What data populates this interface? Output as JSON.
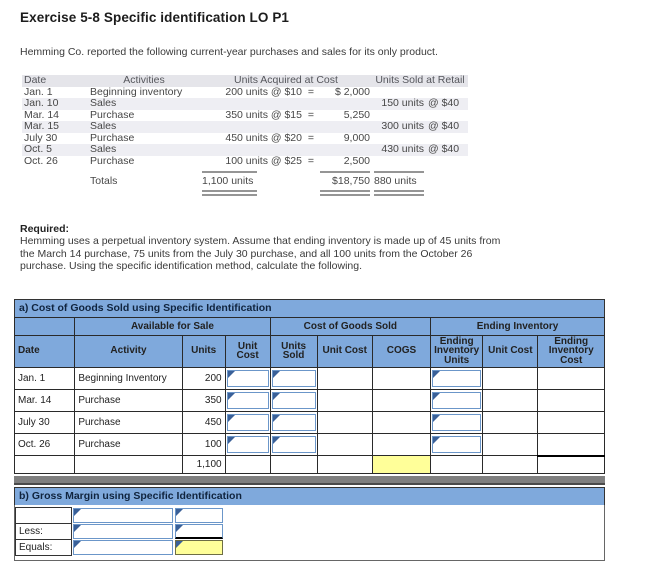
{
  "page": {
    "title": "Exercise 5-8 Specific identification LO P1",
    "intro": "Hemming Co. reported the following current-year purchases and sales for its only product.",
    "required_label": "Required:",
    "required_text": "Hemming uses a perpetual inventory system. Assume that ending inventory is made up of 45 units from the March 14 purchase, 75 units from the July 30 purchase, and all 100 units from the October 26 purchase. Using the specific identification method, calculate the following."
  },
  "purchases_table": {
    "headers": {
      "date": "Date",
      "activities": "Activities",
      "acquired": "Units Acquired at Cost",
      "sold": "Units Sold at Retail"
    },
    "rows": [
      {
        "date": "Jan. 1",
        "activity": "Beginning inventory",
        "acquired": "200 units @ $10",
        "eq": "=",
        "cost": "$ 2,000",
        "sold_units": "",
        "sold_price": ""
      },
      {
        "date": "Jan. 10",
        "activity": "Sales",
        "acquired": "",
        "eq": "",
        "cost": "",
        "sold_units": "150 units",
        "sold_price": "@ $40"
      },
      {
        "date": "Mar. 14",
        "activity": "Purchase",
        "acquired": "350 units @ $15",
        "eq": "=",
        "cost": "5,250",
        "sold_units": "",
        "sold_price": ""
      },
      {
        "date": "Mar. 15",
        "activity": "Sales",
        "acquired": "",
        "eq": "",
        "cost": "",
        "sold_units": "300 units",
        "sold_price": "@ $40"
      },
      {
        "date": "July 30",
        "activity": "Purchase",
        "acquired": "450 units @ $20",
        "eq": "=",
        "cost": "9,000",
        "sold_units": "",
        "sold_price": ""
      },
      {
        "date": "Oct. 5",
        "activity": "Sales",
        "acquired": "",
        "eq": "",
        "cost": "",
        "sold_units": "430 units",
        "sold_price": "@ $40"
      },
      {
        "date": "Oct. 26",
        "activity": "Purchase",
        "acquired": "100 units @ $25",
        "eq": "=",
        "cost": "2,500",
        "sold_units": "",
        "sold_price": ""
      }
    ],
    "totals": {
      "label": "Totals",
      "acquired": "1,100 units",
      "cost": "$18,750",
      "sold_units": "880 units"
    }
  },
  "worksheet_a": {
    "title": "a) Cost of Goods Sold using Specific Identification",
    "group_headers": {
      "available": "Available for Sale",
      "cogs": "Cost of Goods Sold",
      "ending": "Ending Inventory"
    },
    "col_headers": {
      "date": "Date",
      "activity": "Activity",
      "units": "Units",
      "unit_cost": "Unit Cost",
      "units_sold": "Units Sold",
      "unit_cost2": "Unit Cost",
      "cogs": "COGS",
      "ending_units": "Ending Inventory Units",
      "unit_cost3": "Unit Cost",
      "ending_cost": "Ending Inventory Cost"
    },
    "rows": [
      {
        "date": "Jan. 1",
        "activity": "Beginning Inventory",
        "units": "200"
      },
      {
        "date": "Mar. 14",
        "activity": "Purchase",
        "units": "350"
      },
      {
        "date": "July 30",
        "activity": "Purchase",
        "units": "450"
      },
      {
        "date": "Oct. 26",
        "activity": "Purchase",
        "units": "100"
      }
    ],
    "totals": {
      "units": "1,100"
    }
  },
  "worksheet_b": {
    "title": "b) Gross Margin using Specific Identification",
    "rows": [
      {
        "label": ""
      },
      {
        "label": "Less:"
      },
      {
        "label": "Equals:"
      }
    ]
  },
  "colors": {
    "header_blue": "#7FA9DC",
    "header_text": "#17365D",
    "highlight_yellow": "#FFFF99",
    "input_border_blue": "#6B96C9",
    "input_marker_blue": "#3A6098",
    "divider_gray": "#7F7F7F",
    "purchases_header_bg": "#E5E5EA",
    "row_stripe": "#EEEEF3"
  }
}
